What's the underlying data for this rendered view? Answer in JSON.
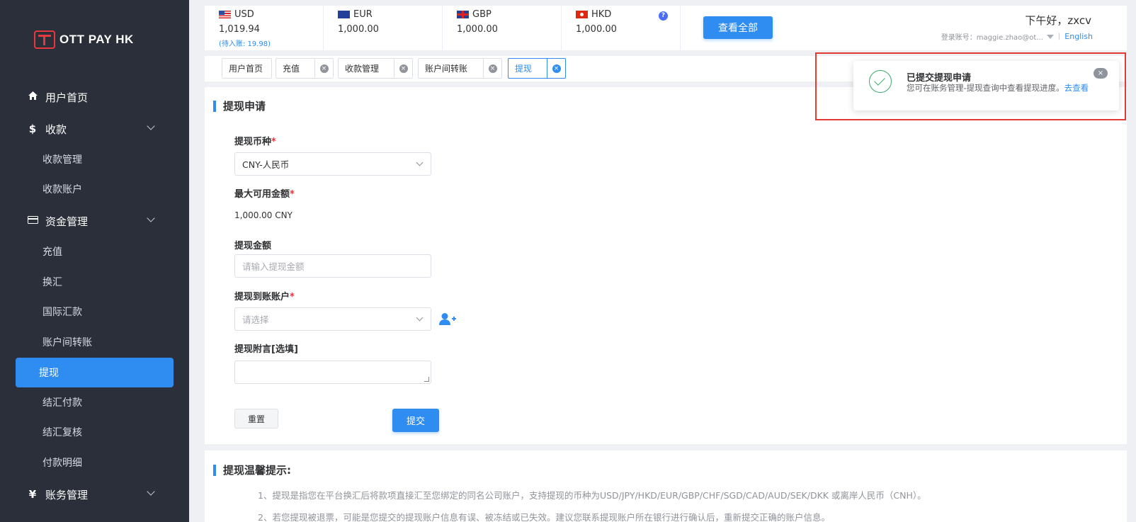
{
  "brand": {
    "name": "OTT PAY HK",
    "logo_color": "#e5393e"
  },
  "colors": {
    "primary": "#2f8cf0",
    "sidebar_bg": "#2b2f3a",
    "required": "#e5393e",
    "success": "#3aa86b",
    "highlight": "#e53935"
  },
  "sidebar": {
    "items": [
      {
        "label": "用户首页",
        "icon": "home-icon",
        "type": "top"
      },
      {
        "label": "收款",
        "icon": "dollar-icon",
        "type": "top",
        "expandable": true
      },
      {
        "label": "收款管理",
        "type": "sub"
      },
      {
        "label": "收款账户",
        "type": "sub"
      },
      {
        "label": "资金管理",
        "icon": "card-icon",
        "type": "top",
        "expandable": true
      },
      {
        "label": "充值",
        "type": "sub"
      },
      {
        "label": "换汇",
        "type": "sub"
      },
      {
        "label": "国际汇款",
        "type": "sub"
      },
      {
        "label": "账户间转账",
        "type": "sub"
      },
      {
        "label": "提现",
        "type": "sub",
        "active": true
      },
      {
        "label": "结汇付款",
        "type": "sub"
      },
      {
        "label": "结汇复核",
        "type": "sub"
      },
      {
        "label": "付款明细",
        "type": "sub"
      },
      {
        "label": "账务管理",
        "icon": "yen-icon",
        "type": "top",
        "expandable": true
      }
    ]
  },
  "header": {
    "currencies": [
      {
        "code": "USD",
        "amount": "1,019.94",
        "pending": "(待入账: 19.98)"
      },
      {
        "code": "EUR",
        "amount": "1,000.00"
      },
      {
        "code": "GBP",
        "amount": "1,000.00"
      },
      {
        "code": "HKD",
        "amount": "1,000.00"
      }
    ],
    "help_icon": "?",
    "view_all_label": "查看全部",
    "greeting": "下午好，zxcv",
    "login_label": "登录账号：maggie.zhao@ot...",
    "separator": "|",
    "language": "English"
  },
  "tabs": [
    {
      "label": "用户首页",
      "closable": false
    },
    {
      "label": "充值",
      "closable": true
    },
    {
      "label": "收款管理",
      "closable": true
    },
    {
      "label": "账户间转账",
      "closable": true
    },
    {
      "label": "提现",
      "closable": true,
      "active": true
    }
  ],
  "form": {
    "title": "提现申请",
    "currency_label": "提现币种",
    "currency_value": "CNY-人民币",
    "max_label": "最大可用金额",
    "max_value": "1,000.00 CNY",
    "amount_label": "提现金额",
    "amount_placeholder": "请输入提现金额",
    "account_label": "提现到账账户",
    "account_placeholder": "请选择",
    "note_label": "提现附言[选填]",
    "note_value": "",
    "required_mark": "*",
    "reset_label": "重置",
    "submit_label": "提交"
  },
  "tips": {
    "title": "提现温馨提示:",
    "lines": [
      "1、提现是指您在平台换汇后将款项直接汇至您绑定的同名公司账户，支持提现的币种为USD/JPY/HKD/EUR/GBP/CHF/SGD/CAD/AUD/SEK/DKK 或离岸人民币（CNH）。",
      "2、若您提现被退票，可能是您提交的提现账户信息有误、被冻结或已失效。建议您联系提现账户所在银行进行确认后，重新提交正确的账户信息。"
    ]
  },
  "notification": {
    "title": "已提交提现申请",
    "message": "您可在账务管理-提现查询中查看提现进度。",
    "link_label": "去查看",
    "close_icon": "×"
  }
}
